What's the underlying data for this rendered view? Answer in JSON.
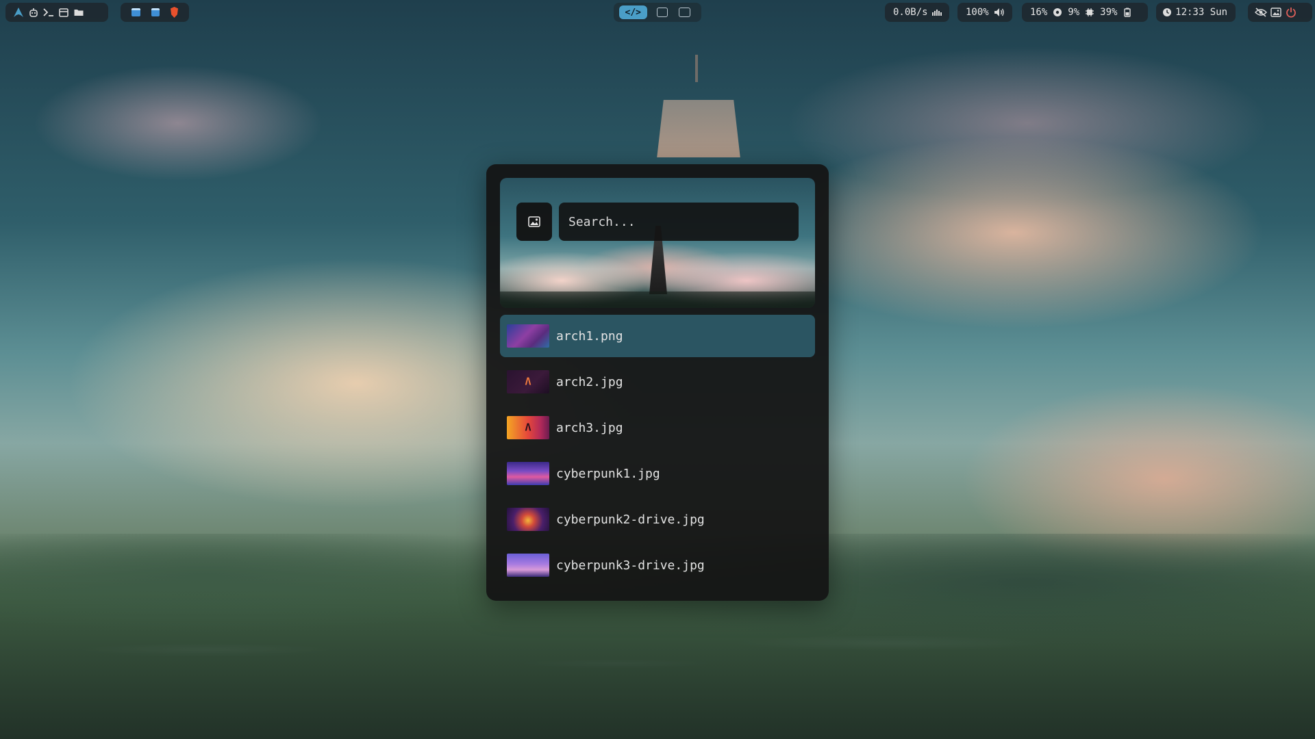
{
  "topbar": {
    "launcher_icons": [
      "arch-logo-icon",
      "bot-icon",
      "terminal-icon",
      "calendar-icon",
      "folder-icon"
    ],
    "apps": [
      "window-icon",
      "window-icon",
      "brave-browser-icon"
    ],
    "workspaces": {
      "active_label": "</>",
      "others": [
        "calendar-workspace-icon",
        "folder-workspace-icon"
      ]
    },
    "network": {
      "value": "0.0B/s"
    },
    "volume": {
      "value": "100%"
    },
    "cpu": {
      "value": "16%"
    },
    "memory": {
      "value": "9%"
    },
    "battery": {
      "value": "39%"
    },
    "clock": {
      "value": "12:33 Sun"
    },
    "right_icons": [
      "eye-off-icon",
      "image-icon",
      "power-icon"
    ]
  },
  "launcher": {
    "search": {
      "placeholder": "Search..."
    },
    "items": [
      {
        "label": "arch1.png",
        "selected": true
      },
      {
        "label": "arch2.jpg",
        "selected": false
      },
      {
        "label": "arch3.jpg",
        "selected": false
      },
      {
        "label": "cyberpunk1.jpg",
        "selected": false
      },
      {
        "label": "cyberpunk2-drive.jpg",
        "selected": false
      },
      {
        "label": "cyberpunk3-drive.jpg",
        "selected": false
      }
    ]
  },
  "colors": {
    "accent": "#4a9ec7",
    "selected_row": "#2b5562",
    "panel_bg": "#141414"
  }
}
